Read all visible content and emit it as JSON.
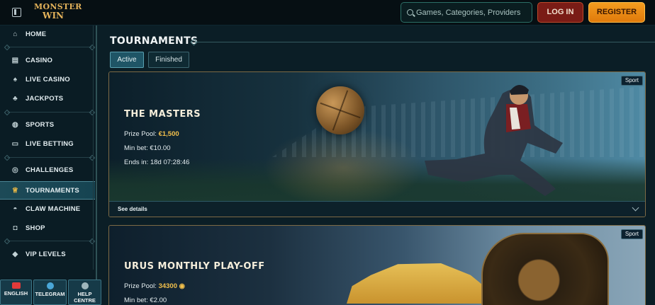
{
  "header": {
    "logo_line1": "MONSTER",
    "logo_line2": "WIN",
    "search_placeholder": "Games, Categories, Providers",
    "login_label": "LOG IN",
    "register_label": "REGISTER"
  },
  "sidebar": {
    "items": [
      {
        "label": "HOME",
        "icon": "home-icon",
        "glyph": "⌂"
      },
      {
        "label": "CASINO",
        "icon": "slot-machine-icon",
        "glyph": "▤"
      },
      {
        "label": "LIVE CASINO",
        "icon": "cards-icon",
        "glyph": "♠"
      },
      {
        "label": "JACKPOTS",
        "icon": "clover-icon",
        "glyph": "♣"
      },
      {
        "label": "SPORTS",
        "icon": "ball-icon",
        "glyph": "◍"
      },
      {
        "label": "LIVE BETTING",
        "icon": "live-icon",
        "glyph": "▭"
      },
      {
        "label": "CHALLENGES",
        "icon": "target-icon",
        "glyph": "◎"
      },
      {
        "label": "TOURNAMENTS",
        "icon": "trophy-icon",
        "glyph": "♕"
      },
      {
        "label": "CLAW MACHINE",
        "icon": "claw-icon",
        "glyph": "◓"
      },
      {
        "label": "SHOP",
        "icon": "basket-icon",
        "glyph": "◘"
      },
      {
        "label": "VIP LEVELS",
        "icon": "diamond-icon",
        "glyph": "◆"
      }
    ],
    "footer": {
      "language_label": "ENGLISH",
      "telegram_label": "TELEGRAM",
      "help_label": "HELP CENTRE"
    }
  },
  "main": {
    "title": "TOURNAMENTS",
    "tabs": [
      {
        "label": "Active",
        "active": true
      },
      {
        "label": "Finished",
        "active": false
      }
    ],
    "cards": [
      {
        "tag": "Sport",
        "title": "THE MASTERS",
        "prize_label": "Prize Pool:",
        "prize_value": "€1,500",
        "min_bet": "Min bet: €10.00",
        "ends_in": "Ends in: 18d 07:28:46",
        "details_label": "See details"
      },
      {
        "tag": "Sport",
        "title": "URUS MONTHLY PLAY-OFF",
        "prize_label": "Prize Pool:",
        "prize_value": "34300",
        "min_bet": "Min bet: €2.00"
      }
    ]
  },
  "colors": {
    "accent_gold": "#f2c04c",
    "register_orange": "#f39c1f",
    "login_red": "#7a1c16",
    "search_teal": "#2c6f66",
    "background": "#0b1e26"
  }
}
